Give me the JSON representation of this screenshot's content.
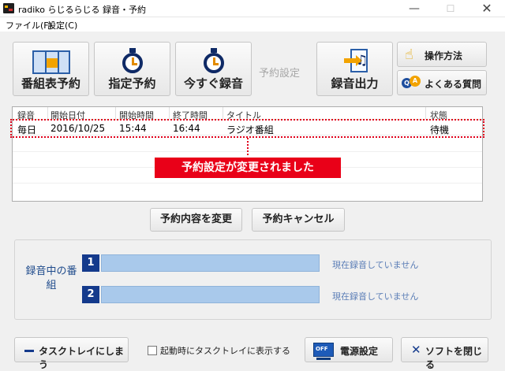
{
  "window": {
    "title": "radiko らじるらじる 録音・予約",
    "minimize_glyph": "—",
    "maximize_glyph": "☐",
    "close_glyph": "✕"
  },
  "menu": {
    "file": "ファイル(F)",
    "settings": "設定(C)"
  },
  "toolbar": {
    "schedule_label": "番組表予約",
    "specify_label": "指定予約",
    "record_now_label": "今すぐ録音",
    "reservation_settings_label": "予約設定",
    "export_label": "録音出力",
    "howto_label": "操作方法",
    "faq_label": "よくある質問"
  },
  "list": {
    "columns": [
      "録音",
      "開始日付",
      "開始時間",
      "終了時間",
      "タイトル",
      "状態"
    ],
    "rows": [
      {
        "repeat": "毎日",
        "date": "2016/10/25",
        "start": "15:44",
        "end": "16:44",
        "title": "ラジオ番組",
        "status": "待機"
      }
    ]
  },
  "notice": "予約設定が変更されました",
  "actions": {
    "change_label": "予約内容を変更",
    "cancel_label": "予約キャンセル"
  },
  "recording_panel": {
    "label": "録音中の番組",
    "slots": [
      {
        "number": "1",
        "status": "現在録音していません",
        "progress": 0
      },
      {
        "number": "2",
        "status": "現在録音していません",
        "progress": 0
      }
    ]
  },
  "bottom": {
    "tray_label": "タスクトレイにしまう",
    "startup_checkbox_label": "起動時にタスクトレイに表示する",
    "startup_checked": false,
    "power_label": "電源設定",
    "exit_label": "ソフトを閉じる"
  },
  "colors": {
    "accent": "#143a8c",
    "callout": "#e90018",
    "slot_bar": "#a9c9eb",
    "status_text": "#5a7db6"
  }
}
